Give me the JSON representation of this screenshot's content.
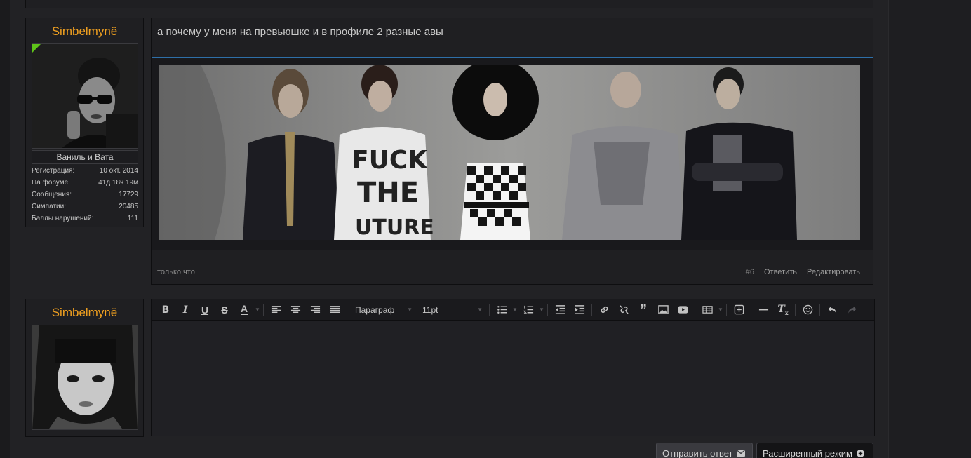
{
  "post": {
    "username": "Simbelmynë",
    "user_title": "Ваниль и Вата",
    "stats": [
      {
        "label": "Регистрация:",
        "value": "10 окт. 2014"
      },
      {
        "label": "На форуме:",
        "value": "41д 18ч 19м"
      },
      {
        "label": "Сообщения:",
        "value": "17729"
      },
      {
        "label": "Симпатии:",
        "value": "20485"
      },
      {
        "label": "Баллы нарушений:",
        "value": "111"
      }
    ],
    "text": "а почему у меня на превьюшке и в профиле 2 разные авы",
    "time": "только что",
    "post_number": "#6",
    "reply_label": "Ответить",
    "edit_label": "Редактировать"
  },
  "reply": {
    "username": "Simbelmynë",
    "format_select": "Параграф",
    "size_select": "11pt",
    "send_label": "Отправить ответ",
    "advanced_label": "Расширенный режим"
  },
  "colors": {
    "username": "#f0a020",
    "online": "#5ec419",
    "separator": "#2e6fa8"
  }
}
